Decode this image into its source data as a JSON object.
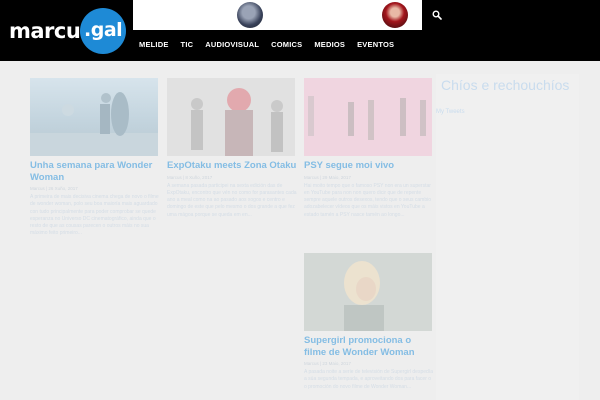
{
  "logo": {
    "left": "marcus",
    "right": ".gal"
  },
  "nav": [
    "MELIDE",
    "TIC",
    "AUDIOVISUAL",
    "COMICS",
    "MEDIOS",
    "EVENTOS"
  ],
  "posts": [
    {
      "title": "Unha semana para Wonder Woman",
      "meta": "Marcus | 26 Xuño, 2017",
      "excerpt": "A primeira de mais decisiva cinema chega de novo o filme de wonder woman, polo seu boa maioría mais aguardado con tudo principalmente para poder comprobar se quede esperanza no Universo DC cinematográfico, ainda que o resto de que as cousas parecen o outros máis no sua máximo feito primeiro..."
    },
    {
      "title": "ExpOtaku meets Zona Otaku",
      "meta": "Marcus | 8 Xuño, 2017",
      "excerpt": "A semana pasada participei na sexta edición das de ExpOtaku, encontro que vén no como for parasantes cada ano a meal como na ao pasado aos xogos e centro e domingo de este que pelo mesmo o dos grande a que fez uma mágoa porque se queda em en..."
    },
    {
      "title": "PSY segue moi vivo",
      "meta": "Marcus | 29 Maio, 2017",
      "excerpt": "Hai moito tempo que o famoso PSY non era un superstar en YouTube para non non quero dicir que de repente sempre aquele outros desexos, tendo que o seus cambio adozabelecer vídeos que os máis vistos en YouTube a estado tamén a PSY nasce tamén ao longo..."
    },
    {
      "title": "Supergirl promociona o filme de Wonder Woman",
      "meta": "Marcus | 23 Maio, 2017",
      "excerpt": "A pasada noite a serie de televisión de Supergirl despedía a súa segunda tempada, e aproveitando dos para facer o o promoción do novo filme de Wonder Woman..."
    }
  ],
  "sidebar": {
    "title": "Chíos e rechouchíos",
    "link": "My Tweets"
  }
}
